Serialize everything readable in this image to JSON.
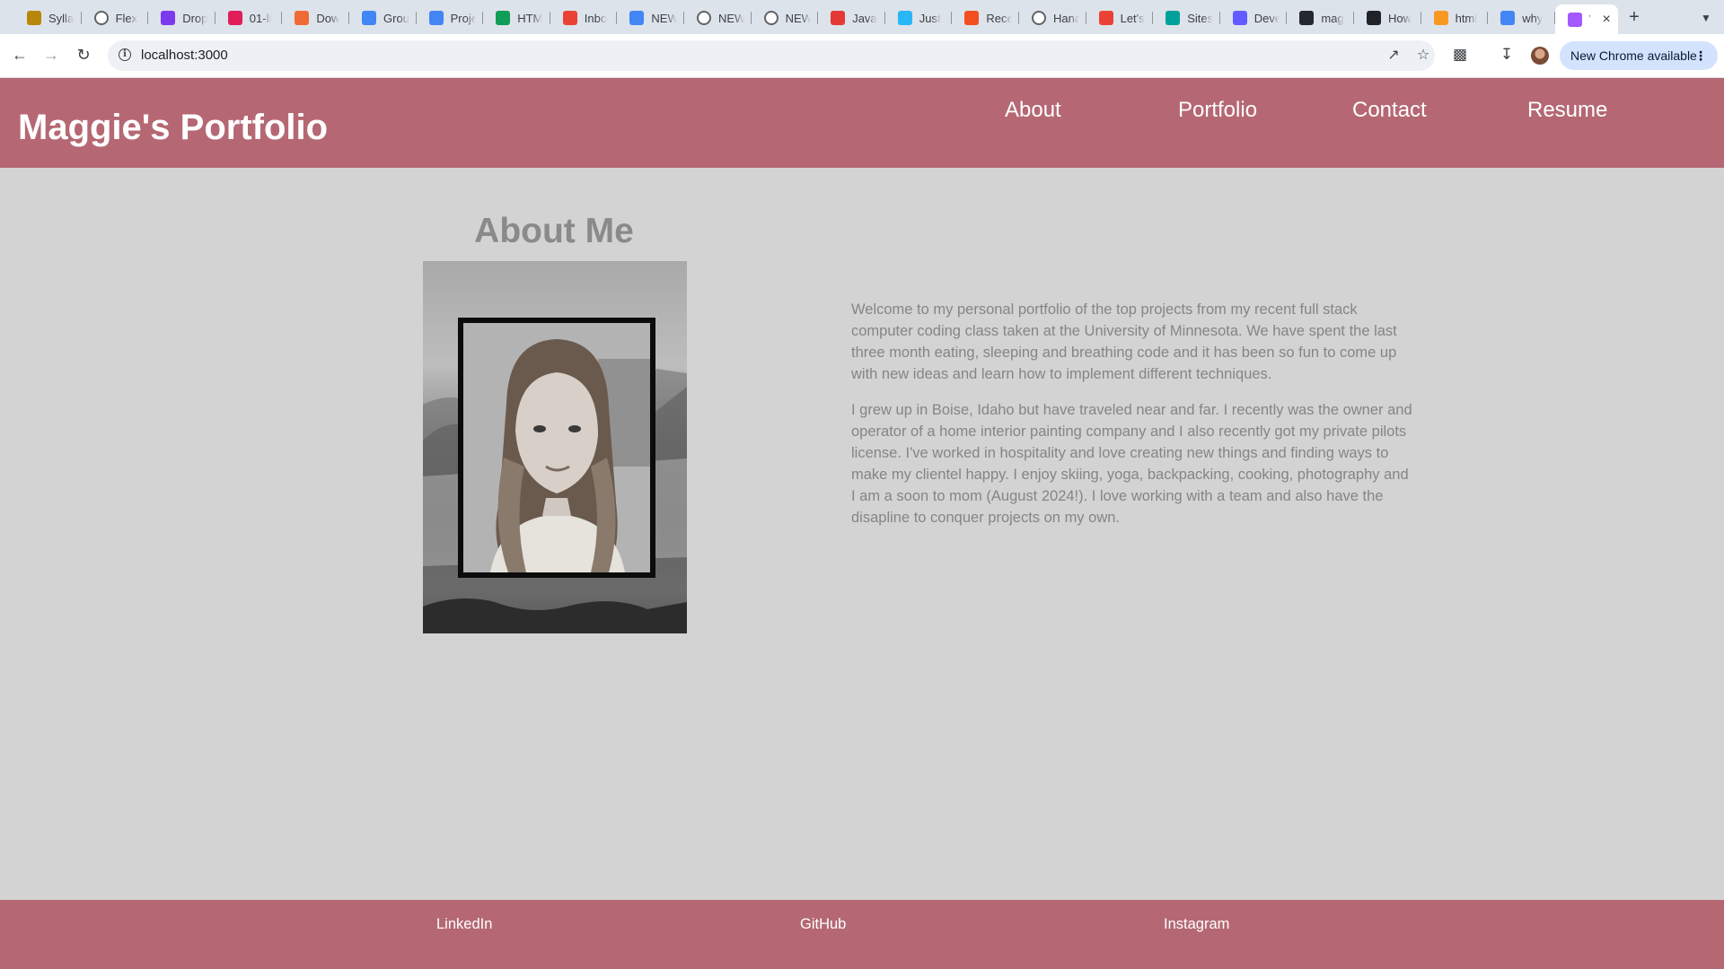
{
  "browser": {
    "tabs": [
      {
        "label": "Sylla",
        "favicon": "m-icon",
        "color": "#b8860b"
      },
      {
        "label": "Flex",
        "favicon": "globe-icon",
        "color": "#5f6368"
      },
      {
        "label": "Drop",
        "favicon": "b-icon",
        "color": "#7c3aed"
      },
      {
        "label": "01-li",
        "favicon": "slack-icon",
        "color": "#e01e5a"
      },
      {
        "label": "Dow",
        "favicon": "drop-icon",
        "color": "#f06a35"
      },
      {
        "label": "Grou",
        "favicon": "docs-icon",
        "color": "#4285f4"
      },
      {
        "label": "Proje",
        "favicon": "docs-icon",
        "color": "#4285f4"
      },
      {
        "label": "HTM",
        "favicon": "w-icon",
        "color": "#0f9d58"
      },
      {
        "label": "Inbo",
        "favicon": "gmail-icon",
        "color": "#ea4335"
      },
      {
        "label": "NEW",
        "favicon": "docs-icon",
        "color": "#4285f4"
      },
      {
        "label": "NEW",
        "favicon": "globe-icon",
        "color": "#5f6368"
      },
      {
        "label": "NEW",
        "favicon": "globe-icon",
        "color": "#5f6368"
      },
      {
        "label": "Java",
        "favicon": "target-icon",
        "color": "#e53935"
      },
      {
        "label": "Just",
        "favicon": "book-icon",
        "color": "#29b6f6"
      },
      {
        "label": "Rece",
        "favicon": "figma-icon",
        "color": "#f24e1e"
      },
      {
        "label": "Hana",
        "favicon": "globe-icon",
        "color": "#5f6368"
      },
      {
        "label": "Let's",
        "favicon": "gmail-icon",
        "color": "#ea4335"
      },
      {
        "label": "Sites",
        "favicon": "diamond-icon",
        "color": "#00a19a"
      },
      {
        "label": "Deve",
        "favicon": "s-icon",
        "color": "#635bff"
      },
      {
        "label": "mag",
        "favicon": "github-icon",
        "color": "#24292f"
      },
      {
        "label": "How",
        "favicon": "dark-icon",
        "color": "#1f2328"
      },
      {
        "label": "html",
        "favicon": "java-icon",
        "color": "#f89820"
      },
      {
        "label": "why",
        "favicon": "google-icon",
        "color": "#4285f4"
      },
      {
        "label": "V",
        "favicon": "vite-icon",
        "color": "#a259ff"
      }
    ],
    "url": "localhost:3000",
    "update_label": "New Chrome available",
    "new_tab_symbol": "+",
    "tab_close_symbol": "×"
  },
  "site": {
    "title": "Maggie's Portfolio",
    "nav": [
      "About",
      "Portfolio",
      "Contact",
      "Resume"
    ]
  },
  "about": {
    "heading": "About Me",
    "image_alt": "portrait of Maggie",
    "paragraphs": [
      "Welcome to my personal portfolio of the top projects from my recent full stack computer coding class taken at the University of Minnesota. We have spent the last three month eating, sleeping and breathing code and it has been so fun to come up with new ideas and learn how to implement different techniques.",
      "I grew up in Boise, Idaho but have traveled near and far. I recently was the owner and operator of a home interior painting company and I also recently got my private pilots license. I've worked in hospitality and love creating new things and finding ways to make my clientel happy. I enjoy skiing, yoga, backpacking, cooking, photography and I am a soon to mom (August 2024!). I love working with a team and also have the disapline to conquer projects on my own."
    ]
  },
  "footer": {
    "links": [
      "LinkedIn",
      "GitHub",
      "Instagram"
    ]
  },
  "colors": {
    "brand": "#b56873",
    "page_bg": "#d3d3d3",
    "text_muted": "#858585"
  }
}
